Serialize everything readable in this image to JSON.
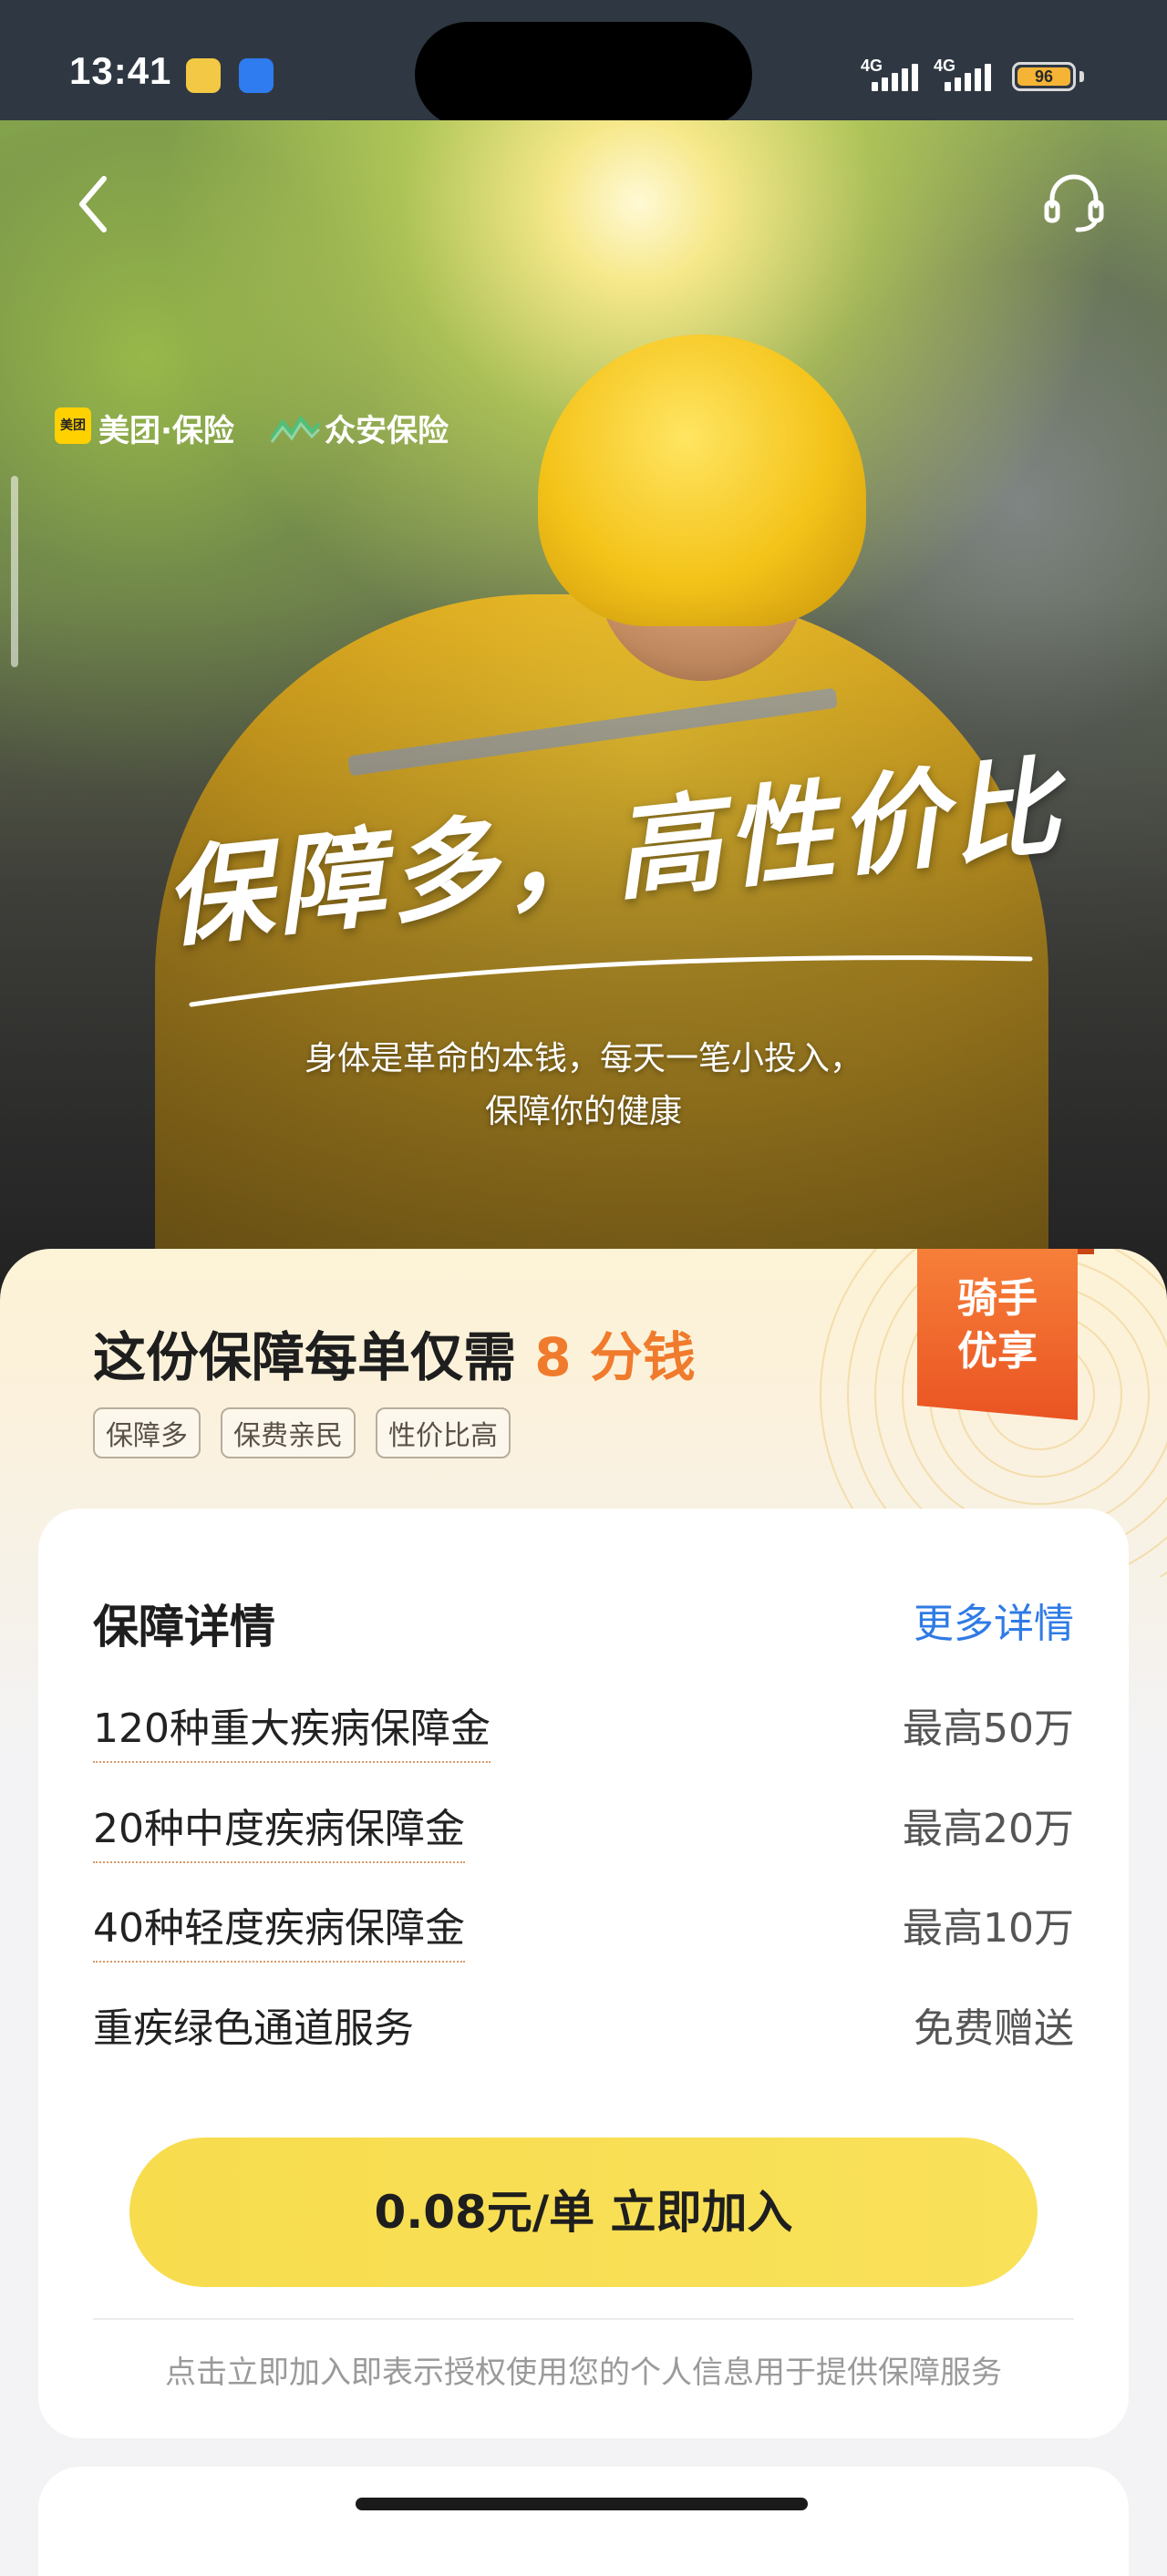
{
  "status_bar": {
    "time": "13:41",
    "network_1": "4G",
    "network_2": "4G",
    "battery": "96"
  },
  "hero": {
    "back_icon": "chevron-left-icon",
    "support_icon": "headset-icon",
    "logo_meituan_badge": "美团",
    "logo_meituan": "美团·保险",
    "logo_zhongan": "众安保险",
    "slogan": "保障多，高性价比",
    "subtitle_line1": "身体是革命的本钱，每天一笔小投入，",
    "subtitle_line2": "保障你的健康"
  },
  "offer": {
    "title_prefix": "这份保障每单仅需",
    "title_price": "8 分钱",
    "tags": [
      "保障多",
      "保费亲民",
      "性价比高"
    ],
    "ribbon_line1": "骑手",
    "ribbon_line2": "优享"
  },
  "details": {
    "title": "保障详情",
    "more_link": "更多详情",
    "items": [
      {
        "label": "120种重大疾病保障金",
        "value": "最高50万"
      },
      {
        "label": "20种中度疾病保障金",
        "value": "最高20万"
      },
      {
        "label": "40种轻度疾病保障金",
        "value": "最高10万"
      },
      {
        "label": "重疾绿色通道服务",
        "value": "免费赠送"
      }
    ],
    "join_button": "0.08元/单 立即加入",
    "notice": "点击立即加入即表示授权使用您的个人信息用于提供保障服务"
  },
  "colors": {
    "accent_orange": "#f07b2c",
    "button_yellow": "#f9e15a",
    "link_blue": "#2f7be6",
    "ribbon_orange": "#ea5422"
  }
}
